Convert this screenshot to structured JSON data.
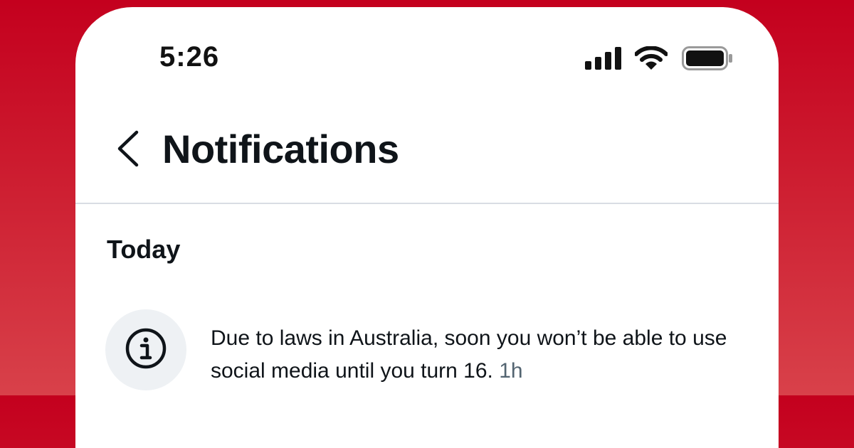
{
  "status_bar": {
    "time": "5:26",
    "icons": [
      "signal-icon",
      "wifi-icon",
      "battery-icon"
    ]
  },
  "header": {
    "back_icon": "chevron-left-icon",
    "title": "Notifications"
  },
  "section": {
    "title": "Today"
  },
  "notifications": [
    {
      "icon": "info-icon",
      "text": "Due to laws in Australia, soon you won’t be able to use social media until you turn 16.",
      "time": "1h"
    }
  ],
  "colors": {
    "background_red": "#c4001e",
    "text_primary": "#0f1419",
    "text_secondary": "#536471",
    "divider": "#d9dde3",
    "icon_badge_bg": "#eef1f4"
  }
}
